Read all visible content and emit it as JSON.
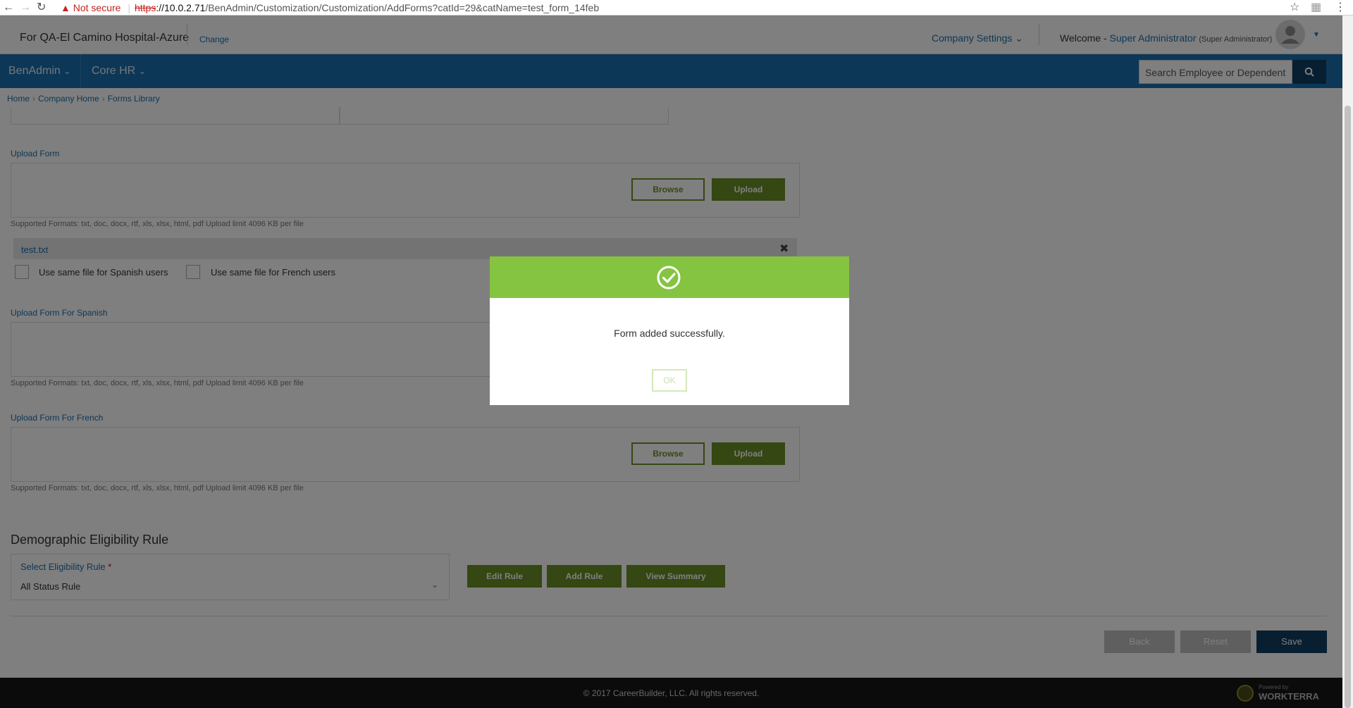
{
  "browser": {
    "warning": "Not secure",
    "url_scheme": "https",
    "url_host": "://10.0.2.71",
    "url_path": "/BenAdmin/Customization/Customization/AddForms?catId=29&catName=test_form_14feb"
  },
  "header": {
    "client_name": "For QA-El Camino Hospital-Azure",
    "change_label": "Change",
    "company_settings": "Company Settings",
    "welcome": "Welcome -",
    "user_name": "Super Administrator",
    "user_role": "(Super Administrator)"
  },
  "nav": {
    "items": [
      {
        "label": "BenAdmin"
      },
      {
        "label": "Core HR"
      }
    ],
    "search_placeholder": "Search Employee or Dependent"
  },
  "breadcrumb": [
    "Home",
    "Company Home",
    "Forms Library"
  ],
  "form": {
    "upload_form": {
      "label": "Upload Form",
      "browse": "Browse",
      "upload": "Upload",
      "formats": "Supported Formats: txt, doc, docx, rtf, xls, xlsx, html, pdf Upload limit 4096 KB per file"
    },
    "uploaded_file": "test.txt",
    "checkbox_spanish": "Use same file for Spanish users",
    "checkbox_french": "Use same file for French users",
    "upload_spanish": {
      "label": "Upload Form For Spanish",
      "formats": "Supported Formats: txt, doc, docx, rtf, xls, xlsx, html, pdf Upload limit 4096 KB per file"
    },
    "upload_french": {
      "label": "Upload Form For French",
      "browse": "Browse",
      "upload": "Upload",
      "formats": "Supported Formats: txt, doc, docx, rtf, xls, xlsx, html, pdf Upload limit 4096 KB per file"
    }
  },
  "eligibility": {
    "title": "Demographic Eligibility Rule",
    "select_label": "Select Eligibility Rule",
    "required_mark": "*",
    "selected_value": "All Status Rule",
    "edit_rule": "Edit Rule",
    "add_rule": "Add Rule",
    "view_summary": "View Summary"
  },
  "actions": {
    "back": "Back",
    "reset": "Reset",
    "save": "Save"
  },
  "footer": {
    "copyright": "© 2017 CareerBuilder, LLC. All rights reserved.",
    "powered_by": "Powered by",
    "brand": "WORKTERRA"
  },
  "modal": {
    "message": "Form added successfully.",
    "ok": "OK"
  },
  "colors": {
    "brand_blue": "#1a6fae",
    "dark_navy": "#0f3e62",
    "green": "#6a8e24",
    "success_green": "#84c441"
  }
}
